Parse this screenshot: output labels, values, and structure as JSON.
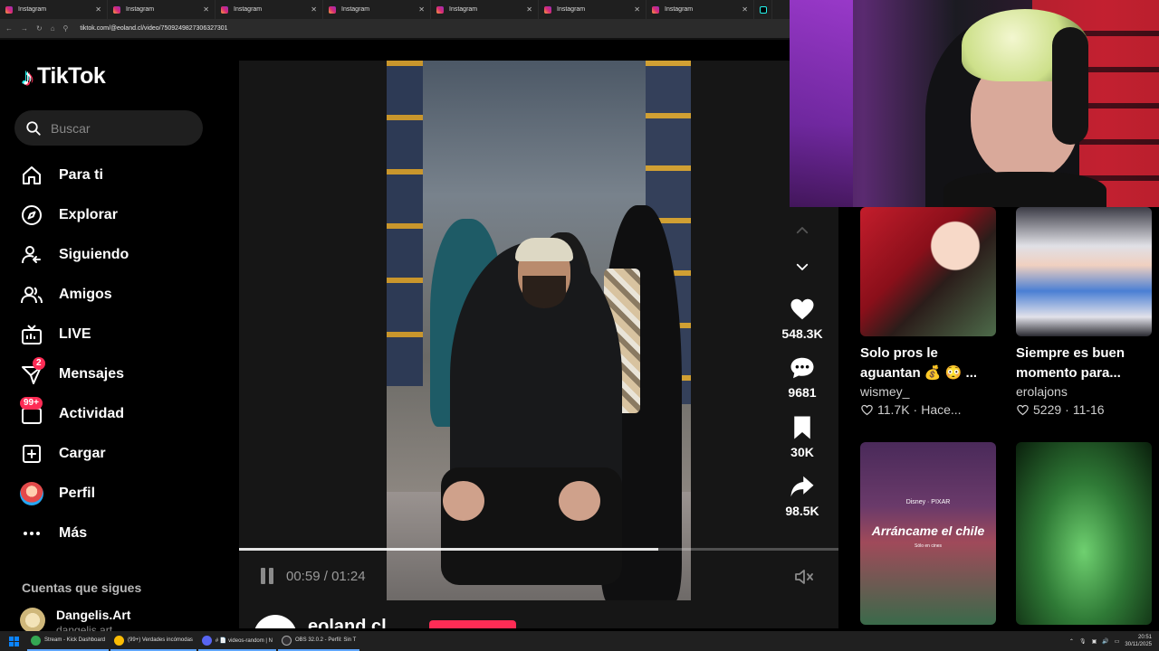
{
  "browser": {
    "tabs": [
      {
        "title": "Instagram"
      },
      {
        "title": "Instagram"
      },
      {
        "title": "Instagram"
      },
      {
        "title": "Instagram"
      },
      {
        "title": "Instagram"
      },
      {
        "title": "Instagram"
      },
      {
        "title": "Instagram"
      }
    ],
    "url": "tiktok.com/@eoland.cl/video/7509249827306327301"
  },
  "sidebar": {
    "brand": "TikTok",
    "search_placeholder": "Buscar",
    "items": [
      {
        "label": "Para ti",
        "icon": "home-icon"
      },
      {
        "label": "Explorar",
        "icon": "compass-icon"
      },
      {
        "label": "Siguiendo",
        "icon": "following-icon"
      },
      {
        "label": "Amigos",
        "icon": "friends-icon"
      },
      {
        "label": "LIVE",
        "icon": "live-icon"
      },
      {
        "label": "Mensajes",
        "icon": "messages-icon",
        "badge": "2"
      },
      {
        "label": "Actividad",
        "icon": "activity-icon",
        "badge": "99+"
      },
      {
        "label": "Cargar",
        "icon": "upload-icon"
      },
      {
        "label": "Perfil",
        "icon": "avatar"
      },
      {
        "label": "Más",
        "icon": "more-icon"
      }
    ],
    "following_title": "Cuentas que sigues",
    "following": [
      {
        "name": "Dangelis.Art",
        "handle": "dangelis.art"
      }
    ]
  },
  "video": {
    "current_time": "00:59",
    "duration": "01:24",
    "progress": 0.7,
    "author": "eoland.cl"
  },
  "actions": {
    "likes": "548.3K",
    "comments": "9681",
    "saves": "30K",
    "shares": "98.5K"
  },
  "grid": [
    {
      "title": "Solo pros le aguantan 💰 😳 ...",
      "author": "wismey_",
      "likes": "11.7K",
      "date": "Hace...",
      "theme": "anime"
    },
    {
      "title": "Siempre es buen momento para...",
      "author": "erolajons",
      "likes": "5229",
      "date": "11-16",
      "theme": "fashion"
    },
    {
      "title": "",
      "author": "",
      "likes": "",
      "date": "",
      "theme": "movie",
      "overlay_brand": "Disney · PIXAR",
      "overlay_title": "Arráncame el chile",
      "overlay_sub": "Sólo en cines"
    },
    {
      "title": "",
      "author": "",
      "likes": "",
      "date": "",
      "theme": "green"
    }
  ],
  "taskbar": {
    "items": [
      {
        "label": "Stream - Kick Dashboard",
        "color": "#34a853"
      },
      {
        "label": "(99+) Verdades incómodas",
        "color": "#fbbc04"
      },
      {
        "label": "# 📄 videos-random | N",
        "color": "#5865f2"
      },
      {
        "label": "OBS 32.0.2 - Perfil: Sin T",
        "color": "#302e31"
      }
    ],
    "time": "20:51",
    "date": "30/11/2025"
  },
  "colors": {
    "accent": "#fe2c55",
    "cyan": "#25f4ee"
  }
}
